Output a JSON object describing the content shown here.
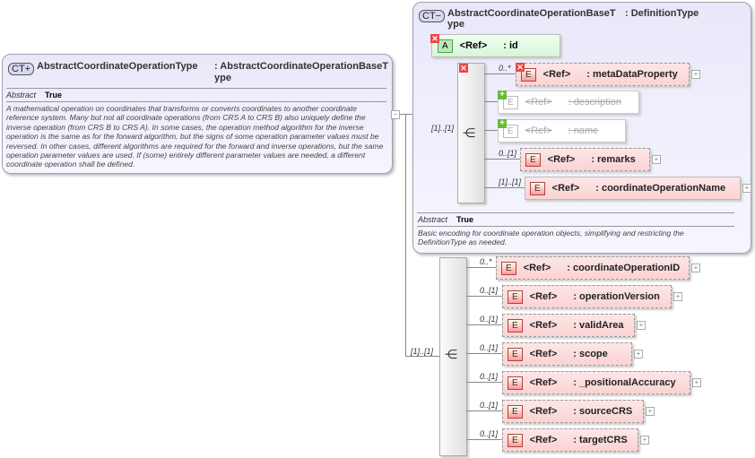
{
  "left_type": {
    "badge": "CT+",
    "name": "AbstractCoordinateOperationType",
    "base": ": AbstractCoordinateOperationBaseT",
    "base_wrap": "ype",
    "abstract_label": "Abstract",
    "abstract_value": "True",
    "doc": "A mathematical operation on coordinates that transforms or converts coordinates to another coordinate reference system. Many but not all coordinate operations (from CRS A to CRS B) also uniquely define the inverse operation (from CRS B to CRS A). In some cases, the operation method algorithm for the inverse operation is the same as for the forward algorithm, but the signs of some operation parameter values must be reversed. In other cases, different algorithms are required for the forward and inverse operations, but the same operation parameter values are used. If (some) entirely different parameter values are needed, a different coordinate operation shall be defined."
  },
  "base_type": {
    "badge": "CT−",
    "name": "AbstractCoordinateOperationBaseT",
    "base": ": DefinitionType",
    "name_wrap": "ype",
    "abstract_label": "Abstract",
    "abstract_value": "True",
    "doc": "Basic encoding for coordinate operation objects, simplifying and restricting the DefinitionType as needed.",
    "seq_cardinality": "[1]..[1]",
    "attribute": {
      "badge": "A",
      "ref": "<Ref>",
      "name": ": id"
    },
    "elements": [
      {
        "card": "0..*",
        "ref": "<Ref>",
        "name": ": metaDataProperty"
      },
      {
        "card": "",
        "ref": "<Ref>",
        "name": ": description"
      },
      {
        "card": "",
        "ref": "<Ref>",
        "name": ": name"
      },
      {
        "card": "0..[1]",
        "ref": "<Ref>",
        "name": ": remarks"
      },
      {
        "card": "[1]..[1]",
        "ref": "<Ref>",
        "name": ": coordinateOperationName"
      }
    ]
  },
  "sequence": {
    "cardinality": "[1]..[1]",
    "elements": [
      {
        "card": "0..*",
        "ref": "<Ref>",
        "name": ": coordinateOperationID"
      },
      {
        "card": "0..[1]",
        "ref": "<Ref>",
        "name": ": operationVersion"
      },
      {
        "card": "0..[1]",
        "ref": "<Ref>",
        "name": ": validArea"
      },
      {
        "card": "0..[1]",
        "ref": "<Ref>",
        "name": ": scope"
      },
      {
        "card": "0..[1]",
        "ref": "<Ref>",
        "name": ": _positionalAccuracy"
      },
      {
        "card": "0..[1]",
        "ref": "<Ref>",
        "name": ": sourceCRS"
      },
      {
        "card": "0..[1]",
        "ref": "<Ref>",
        "name": ": targetCRS"
      }
    ]
  },
  "element_badge": "E"
}
